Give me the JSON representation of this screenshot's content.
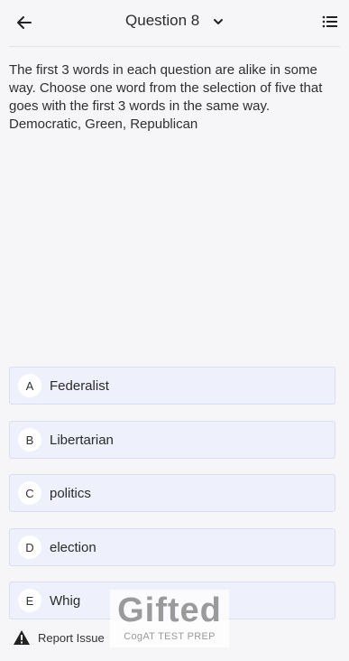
{
  "header": {
    "title": "Question 8",
    "back_icon": "arrow-left-icon",
    "dropdown_icon": "chevron-down-icon",
    "menu_icon": "list-icon"
  },
  "question": {
    "instructions": "The first 3 words in each question are alike in some way. Choose one word from the selection of five that goes with the first 3 words in the same way.",
    "words": "Democratic, Green, Republican"
  },
  "options": [
    {
      "letter": "A",
      "label": "Federalist"
    },
    {
      "letter": "B",
      "label": "Libertarian"
    },
    {
      "letter": "C",
      "label": "politics"
    },
    {
      "letter": "D",
      "label": "election"
    },
    {
      "letter": "E",
      "label": "Whig"
    }
  ],
  "footer": {
    "report_label": "Report Issue",
    "report_icon": "warning-icon"
  },
  "watermark": {
    "brand": "Gifted",
    "tagline": "CogAT TEST PREP"
  },
  "colors": {
    "background": "#f6f6f9",
    "option_fill": "#eef0fb",
    "option_border": "#d9def3"
  }
}
